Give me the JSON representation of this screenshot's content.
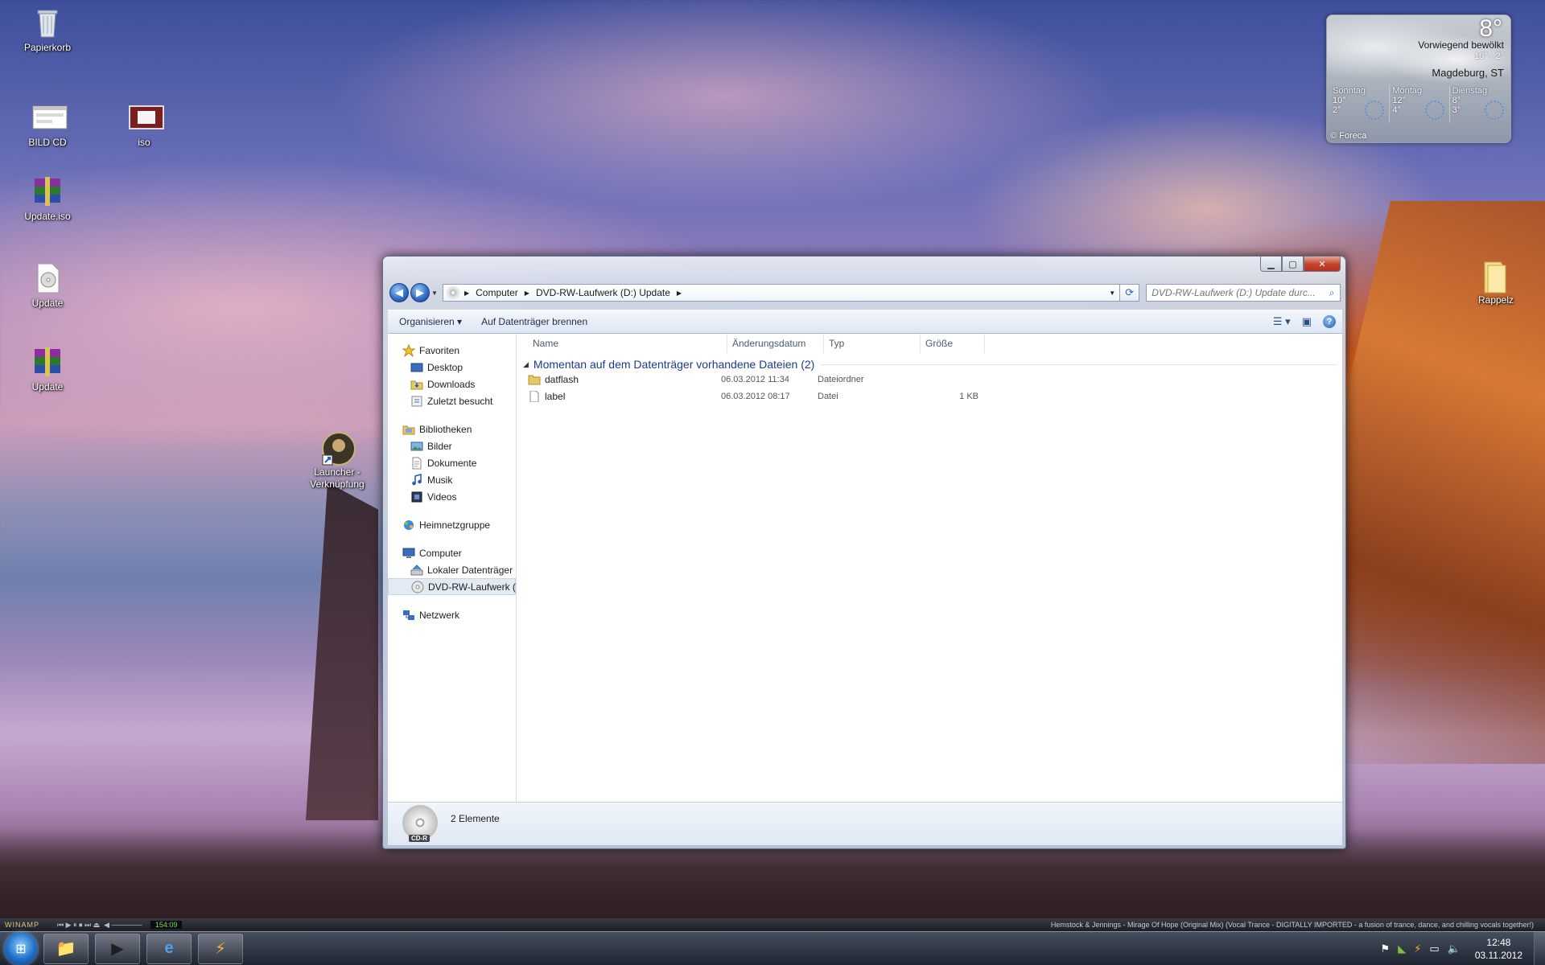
{
  "desktop": {
    "icons": [
      {
        "label": "Papierkorb",
        "icon": "recycle-bin-icon"
      },
      {
        "label": "BILD CD",
        "icon": "image-window-icon"
      },
      {
        "label": "iso",
        "icon": "image-icon"
      },
      {
        "label": "Update.iso",
        "icon": "winrar-archive-icon"
      },
      {
        "label": "Update",
        "icon": "disc-file-icon"
      },
      {
        "label": "Update",
        "icon": "winrar-archive-icon"
      },
      {
        "label": "Launcher - Verknüpfung",
        "icon": "game-shortcut-icon"
      },
      {
        "label": "Rappelz",
        "icon": "folder-icon"
      }
    ]
  },
  "weather": {
    "temp": "8°",
    "condition": "Vorwiegend bewölkt",
    "range": "10° - 2°",
    "city": "Magdeburg, ST",
    "days": [
      {
        "name": "Sonntag",
        "high": "10°",
        "low": "2°"
      },
      {
        "name": "Montag",
        "high": "12°",
        "low": "4°"
      },
      {
        "name": "Dienstag",
        "high": "8°",
        "low": "3°"
      }
    ],
    "credit": "© Foreca"
  },
  "explorer": {
    "breadcrumb": [
      "Computer",
      "DVD-RW-Laufwerk (D:) Update"
    ],
    "search_placeholder": "DVD-RW-Laufwerk (D:) Update durc...",
    "toolbar": {
      "organize": "Organisieren ▾",
      "burn": "Auf Datenträger brennen"
    },
    "nav": {
      "favorites": "Favoriten",
      "desktop": "Desktop",
      "downloads": "Downloads",
      "recent": "Zuletzt besucht",
      "libraries": "Bibliotheken",
      "pictures": "Bilder",
      "documents": "Dokumente",
      "music": "Musik",
      "videos": "Videos",
      "homegroup": "Heimnetzgruppe",
      "computer": "Computer",
      "local_disk": "Lokaler Datenträger",
      "dvd": "DVD-RW-Laufwerk (",
      "network": "Netzwerk"
    },
    "columns": {
      "name": "Name",
      "date": "Änderungsdatum",
      "type": "Typ",
      "size": "Größe"
    },
    "group_title": "Momentan auf dem Datenträger vorhandene Dateien (2)",
    "files": [
      {
        "name": "datflash",
        "date": "06.03.2012 11:34",
        "type": "Dateiordner",
        "size": ""
      },
      {
        "name": "label",
        "date": "06.03.2012 08:17",
        "type": "Datei",
        "size": "1 KB"
      }
    ],
    "status": {
      "count": "2 Elemente",
      "disc_label": "CD-R"
    }
  },
  "winamp": {
    "logo": "WINAMP",
    "time": "154:09",
    "song": "Hemstock & Jennings - Mirage Of Hope (Original Mix) (Vocal Trance - DIGITALLY IMPORTED - a fusion of trance, dance, and chilling vocals together!)"
  },
  "taskbar": {
    "time": "12:48",
    "date": "03.11.2012"
  }
}
